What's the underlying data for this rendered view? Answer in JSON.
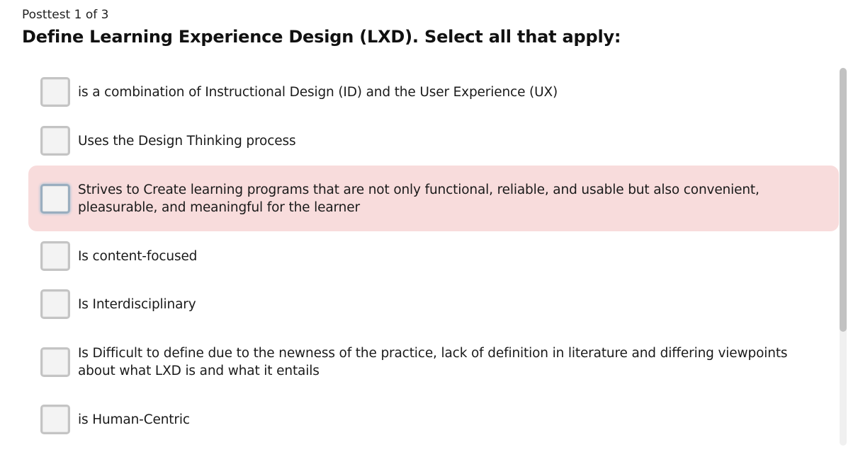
{
  "quiz": {
    "progress": "Posttest 1 of 3",
    "question": "Define Learning Experience Design (LXD).  Select all that apply:"
  },
  "options": [
    {
      "label": "is a combination of Instructional Design (ID) and the User Experience (UX)",
      "checked": false,
      "highlighted": false
    },
    {
      "label": "Uses the Design Thinking process",
      "checked": false,
      "highlighted": false
    },
    {
      "label": "Strives to Create learning programs that are not only functional, reliable, and usable but also convenient, pleasurable, and meaningful for the learner",
      "checked": false,
      "highlighted": true
    },
    {
      "label": "Is content-focused",
      "checked": false,
      "highlighted": false
    },
    {
      "label": "Is Interdisciplinary",
      "checked": false,
      "highlighted": false
    },
    {
      "label": "Is Difficult to define due to the newness of the practice, lack of definition in literature and differing viewpoints about what LXD is and what it entails",
      "checked": false,
      "highlighted": false
    },
    {
      "label": "is Human-Centric",
      "checked": false,
      "highlighted": false
    }
  ],
  "colors": {
    "highlight_background": "#f8dcdc",
    "checkbox_border": "#c4c4c4",
    "scrollbar_thumb": "#c2c2c2"
  }
}
